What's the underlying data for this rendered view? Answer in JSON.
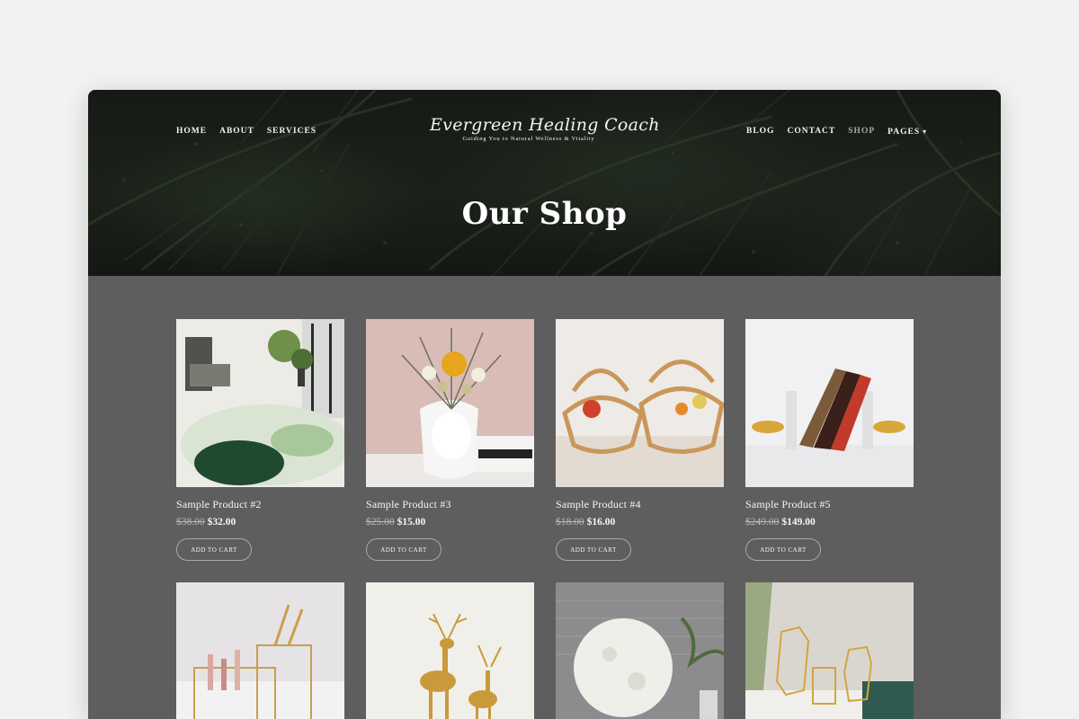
{
  "nav": {
    "left": [
      "HOME",
      "ABOUT",
      "SERVICES"
    ],
    "right": [
      "BLOG",
      "CONTACT",
      "SHOP",
      "PAGES"
    ],
    "active": "SHOP"
  },
  "logo": {
    "title": "Evergreen Healing Coach",
    "tagline": "Guiding You to Natural Wellness & Vitality"
  },
  "hero": {
    "title": "Our Shop"
  },
  "products": [
    {
      "name": "Sample Product #2",
      "old_price": "$38.00",
      "price": "$32.00",
      "button": "ADD TO CART"
    },
    {
      "name": "Sample Product #3",
      "old_price": "$25.00",
      "price": "$15.00",
      "button": "ADD TO CART"
    },
    {
      "name": "Sample Product #4",
      "old_price": "$18.00",
      "price": "$16.00",
      "button": "ADD TO CART"
    },
    {
      "name": "Sample Product #5",
      "old_price": "$249.00",
      "price": "$149.00",
      "button": "ADD TO CART"
    }
  ],
  "colors": {
    "page_bg": "#f2f2f2",
    "content_bg": "#5e5e5e",
    "hero_dark": "#1c221b",
    "text_light": "#f5f5f5",
    "active_nav": "#a9a9a9"
  }
}
